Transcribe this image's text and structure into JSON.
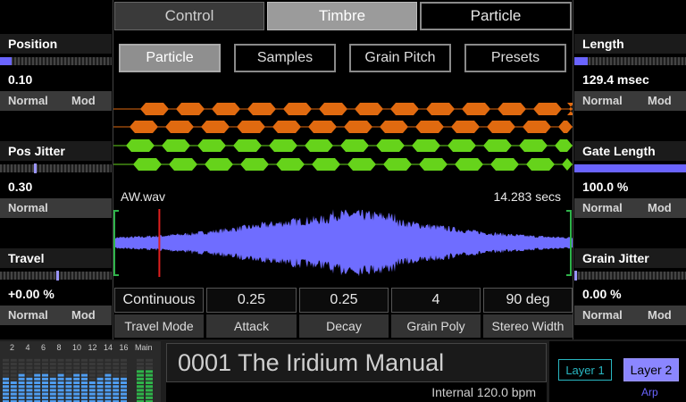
{
  "top_tabs": [
    "Control",
    "Timbre",
    "Particle"
  ],
  "sub_tabs": [
    "Particle",
    "Samples",
    "Grain Pitch",
    "Presets"
  ],
  "left_params": [
    {
      "title": "Position",
      "value": "0.10",
      "mode": "Normal",
      "mod": "Mod",
      "meter_fraction": 0.1
    },
    {
      "title": "Pos Jitter",
      "value": "0.30",
      "mode": "Normal",
      "mod": "",
      "meter_fraction": 0.3
    },
    {
      "title": "Travel",
      "value": "+0.00 %",
      "mode": "Normal",
      "mod": "Mod",
      "meter_fraction": 0.5
    }
  ],
  "right_params": [
    {
      "title": "Length",
      "value": "129.4 msec",
      "mode": "Normal",
      "mod": "Mod",
      "meter_fraction": 0.12
    },
    {
      "title": "Gate Length",
      "value": "100.0 %",
      "mode": "Normal",
      "mod": "Mod",
      "meter_fraction": 1.0
    },
    {
      "title": "Grain Jitter",
      "value": "0.00 %",
      "mode": "Normal",
      "mod": "Mod",
      "meter_fraction": 0.0
    }
  ],
  "waveform": {
    "file": "AW.wav",
    "duration": "14.283 secs",
    "playhead_fraction": 0.1,
    "wave_color": "#6f6dff"
  },
  "grain_rows": [
    {
      "color": "#e06a10"
    },
    {
      "color": "#e06a10"
    },
    {
      "color": "#66d31b"
    },
    {
      "color": "#66d31b"
    }
  ],
  "bottom_params": [
    {
      "value": "Continuous",
      "label": "Travel Mode"
    },
    {
      "value": "0.25",
      "label": "Attack"
    },
    {
      "value": "0.25",
      "label": "Decay"
    },
    {
      "value": "4",
      "label": "Grain Poly"
    },
    {
      "value": "90 deg",
      "label": "Stereo Width"
    }
  ],
  "mixer": {
    "channel_numbers": [
      "2",
      "4",
      "6",
      "8",
      "10",
      "12",
      "14",
      "16"
    ],
    "main_label": "Main"
  },
  "preset": {
    "name": "0001 The Iridium Manual",
    "tempo": "Internal 120.0 bpm"
  },
  "layers": {
    "layer1": "Layer 1",
    "layer2": "Layer 2",
    "arp": "Arp"
  },
  "colors": {
    "accent": "#6a64ff",
    "layer1": "#29b7c2",
    "layer2": "#8b86ff",
    "orange": "#e06a10",
    "green": "#66d31b"
  }
}
